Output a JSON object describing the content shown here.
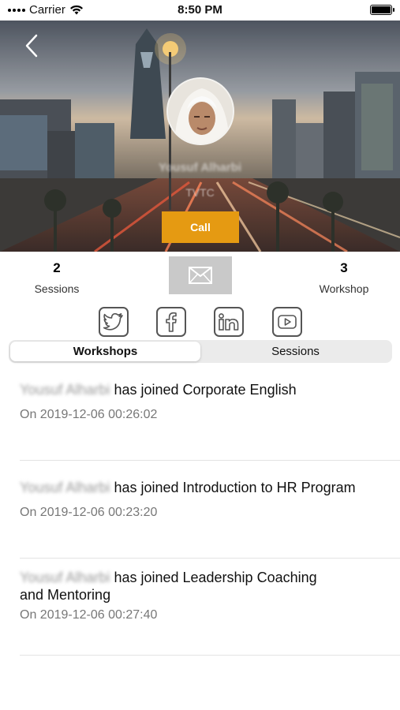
{
  "status_bar": {
    "carrier": "Carrier",
    "time": "8:50 PM"
  },
  "profile": {
    "name": "Yousuf Alharbi",
    "role": "TVTC",
    "call_label": "Call"
  },
  "stats": {
    "sessions_count": "2",
    "sessions_label": "Sessions",
    "workshop_count": "3",
    "workshop_label": "Workshop"
  },
  "social_icons": [
    "twitter-icon",
    "facebook-icon",
    "linkedin-icon",
    "youtube-icon"
  ],
  "tabs": {
    "workshops": "Workshops",
    "sessions": "Sessions",
    "active": "Workshops"
  },
  "feed": [
    {
      "name": "Yousuf Alharbi",
      "action": " has joined Corporate English",
      "date": "On 2019-12-06 00:26:02"
    },
    {
      "name": "Yousuf Alharbi",
      "action": " has joined Introduction to HR Program",
      "date": "On 2019-12-06 00:23:20"
    },
    {
      "name": "Yousuf Alharbi",
      "action": " has joined Leadership Coaching and Mentoring",
      "date": "On 2019-12-06 00:27:40"
    }
  ],
  "colors": {
    "accent": "#e59a12",
    "mail_button": "#c9c9c9"
  }
}
